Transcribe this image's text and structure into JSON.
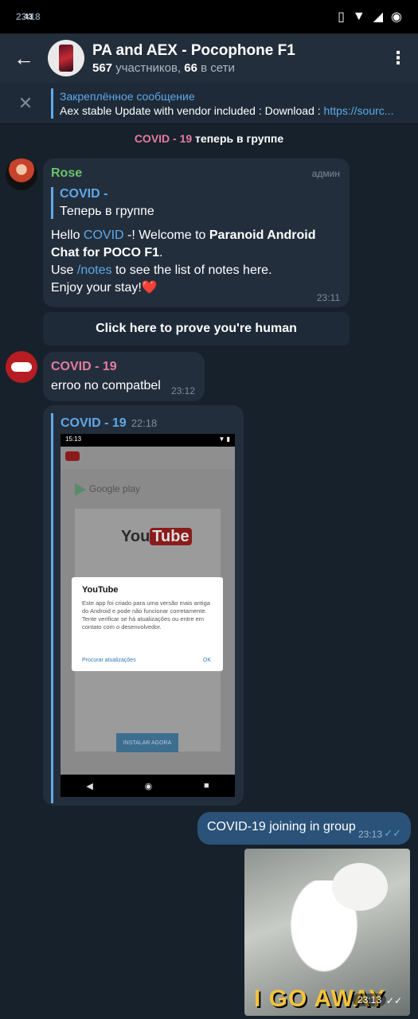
{
  "status": {
    "time": "23:18",
    "sup": "43"
  },
  "header": {
    "title": "PA and AEX - Pocophone F1",
    "members_count": "567",
    "members_label": "участников,",
    "online_count": "66",
    "online_label": "в сети"
  },
  "pinned": {
    "label": "Закреплённое сообщение",
    "text": "Aex stable Update with vendor included : Download : ",
    "link": "https://sourc..."
  },
  "service": {
    "name": "COVID - 19",
    "text": " теперь в группе"
  },
  "msg1": {
    "sender": "Rose",
    "role": "админ",
    "reply_name": "COVID -",
    "reply_text": "Теперь в группе",
    "hello": "Hello ",
    "mention": "COVID",
    "after_mention": " -! Welcome to ",
    "bold1": "Paranoid Android Chat for POCO F1",
    "period": ".",
    "use": "Use ",
    "cmd": "/notes",
    "rest": " to see the list of notes here.",
    "enjoy": "Enjoy your stay!",
    "heart": "❤️",
    "time": "23:11"
  },
  "button": {
    "label": "Click here to prove you're human"
  },
  "msg2": {
    "sender": "COVID - 19",
    "text": "erroo no compatbel",
    "time": "23:12"
  },
  "msg3": {
    "fwd_name": "COVID - 19",
    "fwd_time": "22:18",
    "shot": {
      "status_time": "15:13",
      "store": "Google play",
      "yt_you": "You",
      "yt_tube": "Tube",
      "install": "INSTALAR AGORA",
      "dialog_title": "YouTube",
      "dialog_body": "Este app foi criado para uma versão mais antiga do Android e pode não funcionar corretamente. Tente verificar se há atualizações ou entre em contato com o desenvolvedor.",
      "dialog_left": "Procurar atualizações",
      "dialog_right": "OK"
    }
  },
  "msg4": {
    "text": "COVID-19 joining in group",
    "time": "23:13"
  },
  "sticker": {
    "caption": "I GO AWAY",
    "time": "23:13"
  }
}
